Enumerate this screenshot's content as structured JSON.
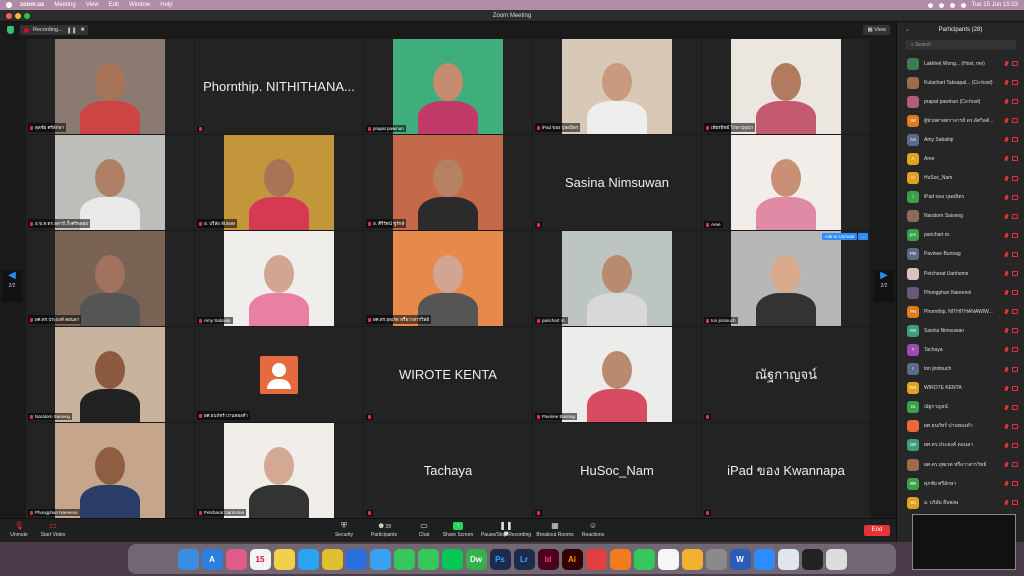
{
  "menubar": {
    "app": "zoom.us",
    "items": [
      "Meeting",
      "View",
      "Edit",
      "Window",
      "Help"
    ],
    "clock": "Tue 15 Jun  15:23"
  },
  "window": {
    "title": "Zoom Meeting"
  },
  "topbar": {
    "recording": "Recording...",
    "view": "View"
  },
  "navigation": {
    "page": "2/2"
  },
  "tiles": [
    {
      "label": "ดุลชัย ศรีลักษา",
      "kind": "video",
      "bg": "#8a7a72",
      "skin": "#a87458",
      "shirt": "#c44"
    },
    {
      "bigname": "Phornthip. NITHITHANA...",
      "kind": "name"
    },
    {
      "label": "prapat pawinun",
      "kind": "video",
      "bg": "#3fae7c",
      "skin": "#c58b6e",
      "shirt": "#c23a6a"
    },
    {
      "label": "iPad ของ บุษยมิตร",
      "kind": "video",
      "bg": "#d7c9b6",
      "skin": "#c99a7e",
      "shirt": "#eee"
    },
    {
      "label": "เพียรพิชย์ โกษาปุลุณา",
      "kind": "video",
      "bg": "#ece6e1",
      "skin": "#b17b60",
      "shirt": "#c35a6f"
    },
    {
      "label": "อ.ข.ท.ดร.ลดาปี ภิ้งศรีพลอย",
      "kind": "video",
      "bg": "#bdbdb9",
      "skin": "#b08066",
      "shirt": "#e9e9e9"
    },
    {
      "label": "อ. บริลัย ลีบพงษ",
      "kind": "video",
      "bg": "#c4963b",
      "skin": "#a87458",
      "shirt": "#d63a53"
    },
    {
      "label": "อ. ศิริรัตน์ ชูรักษ์",
      "kind": "video",
      "bg": "#c46a4a",
      "skin": "#b68063",
      "shirt": "#2b2b2b"
    },
    {
      "bigname": "Sasina Nimsuwan",
      "kind": "name"
    },
    {
      "label": "Aree",
      "kind": "video",
      "bg": "#f2ede8",
      "skin": "#c99076",
      "shirt": "#e08aa6"
    },
    {
      "label": "ผศ.ดร.ประยงค์ ดอนลา",
      "kind": "video",
      "bg": "#7a6355",
      "skin": "#a1735e",
      "shirt": "#555"
    },
    {
      "label": "Amy Sabaitip",
      "kind": "video",
      "bg": "#f0eeeb",
      "skin": "#d2a592",
      "shirt": "#e97fa3"
    },
    {
      "label": "ผศ.ดร.ยุพเรต หรือวาสารวิทย์",
      "kind": "video",
      "bg": "#e8894c",
      "skin": "#d2a592",
      "shirt": "#555"
    },
    {
      "label": "parichart m.",
      "kind": "video",
      "bg": "#bdc5c2",
      "skin": "#b88a70",
      "shirt": "#d8d8d8"
    },
    {
      "label": "ton jirotouch",
      "kind": "video",
      "bg": "#b7b7b7",
      "skin": "#d9a98b",
      "shirt": "#333",
      "ask": "Ask to Unmute",
      "more": "..."
    },
    {
      "label": "Naratorn Saiseng",
      "kind": "video",
      "bg": "#c8b39f",
      "skin": "#8c5a3e",
      "shirt": "#222"
    },
    {
      "label": "ผศ.ธนกัทร์ ปานทองคำ",
      "kind": "avatar"
    },
    {
      "bigname": "WIROTE KENTA",
      "kind": "name"
    },
    {
      "label": "Pavinee Bunnag",
      "kind": "video",
      "bg": "#ececea",
      "skin": "#b98a70",
      "shirt": "#d84c62"
    },
    {
      "bigname": "ณัฐกาญจน์",
      "kind": "name"
    },
    {
      "label": "Phongphan Nareenoi",
      "kind": "video",
      "bg": "#c5a58b",
      "skin": "#8f5e42",
      "shirt": "#2a3d66"
    },
    {
      "label": "Petcharat Uanhome",
      "kind": "video",
      "bg": "#f1eee9",
      "skin": "#d3a994",
      "shirt": "#333"
    },
    {
      "bigname": "Tachaya",
      "kind": "name"
    },
    {
      "bigname": "HuSoc_Nam",
      "kind": "name"
    },
    {
      "bigname": "iPad ของ Kwannapa",
      "kind": "name"
    }
  ],
  "controls": {
    "unmute": "Unmute",
    "start_video": "Start Video",
    "security": "Security",
    "participants": "Participants",
    "participants_count": "28",
    "chat": "Chat",
    "share_screen": "Share Screen",
    "pause_stop": "Pause/Stop Recording",
    "breakout": "Breakout Rooms",
    "reactions": "Reactions",
    "end": "End"
  },
  "panel": {
    "title": "Participants (28)",
    "search_placeholder": "Search",
    "participants": [
      {
        "name": "Lakkhet Wong... (Host, me)",
        "init": "",
        "color": "#3d7a55"
      },
      {
        "name": "Kulachart Taksapal... (Co-host)",
        "init": "",
        "color": "#9b6b4a"
      },
      {
        "name": "prapat pawinun (Co-host)",
        "init": "",
        "color": "#b45b7a"
      },
      {
        "name": "ผู้ช่วยศาสตราจารย์ ดร.อัศวิลต์...",
        "init": "ผศ",
        "color": "#e07a1f"
      },
      {
        "name": "Amy Sabaitip",
        "init": "AS",
        "color": "#5b6b8a"
      },
      {
        "name": "Aree",
        "init": "A",
        "color": "#e0a21f"
      },
      {
        "name": "HuSoc_Nam",
        "init": "H",
        "color": "#e0a21f"
      },
      {
        "name": "iPad ของ บุษยมิตร",
        "init": "i",
        "color": "#3aa04a"
      },
      {
        "name": "Naratorn Saiseng",
        "init": "",
        "color": "#8a6a5a"
      },
      {
        "name": "parichart m.",
        "init": "pm",
        "color": "#3aa04a"
      },
      {
        "name": "Pavinee Bunnag",
        "init": "PB",
        "color": "#5b6b8a"
      },
      {
        "name": "Petcharat Uanhome",
        "init": "",
        "color": "#d7c3bd"
      },
      {
        "name": "Phongphan Nareenoi",
        "init": "",
        "color": "#6a5a7a"
      },
      {
        "name": "Phornthip. NITHITHANAWIW...",
        "init": "PN",
        "color": "#e07a1f"
      },
      {
        "name": "Sasina Nimsuwan",
        "init": "SN",
        "color": "#3aa07a"
      },
      {
        "name": "Tachaya",
        "init": "T",
        "color": "#a04ab4"
      },
      {
        "name": "ton jirotouch",
        "init": "t",
        "color": "#5b6b8a"
      },
      {
        "name": "WIROTE KENTA",
        "init": "WK",
        "color": "#e0a21f"
      },
      {
        "name": "ณัฐกาญจน์",
        "init": "ณ",
        "color": "#3aa04a"
      },
      {
        "name": "ผศ.ธนกัทร์ ปานทองคำ",
        "init": "",
        "color": "#e76a3e"
      },
      {
        "name": "ผศ.ดร.ประยงค์ ดอนลา",
        "init": "ผศ",
        "color": "#3aa07a"
      },
      {
        "name": "ผศ.ดร.ยุพเรต หรือวาสารวิทย์",
        "init": "",
        "color": "#9b6b4a"
      },
      {
        "name": "ศุภชัย ศรีลักษา",
        "init": "ศศ",
        "color": "#3aa04a"
      },
      {
        "name": "อ. บริลัย ลีบพงษ",
        "init": "อบ",
        "color": "#e0a21f"
      }
    ]
  },
  "dock": {
    "icons": [
      {
        "t": "",
        "c": "#3b8de0"
      },
      {
        "t": "A",
        "c": "#2a7fe0"
      },
      {
        "t": "",
        "c": "#e05a8a"
      },
      {
        "t": "15",
        "c": "#f4f4f4",
        "fg": "#e03"
      },
      {
        "t": "",
        "c": "#f4d04a"
      },
      {
        "t": "",
        "c": "#2aa3f0"
      },
      {
        "t": "",
        "c": "#e0c030"
      },
      {
        "t": "",
        "c": "#2a6fe0"
      },
      {
        "t": "",
        "c": "#3aa0f0"
      },
      {
        "t": "",
        "c": "#34c759"
      },
      {
        "t": "",
        "c": "#34c759"
      },
      {
        "t": "",
        "c": "#06c755"
      },
      {
        "t": "Dw",
        "c": "#35b04a"
      },
      {
        "t": "Ps",
        "c": "#1c2b4a",
        "fg": "#31a8ff"
      },
      {
        "t": "Lr",
        "c": "#1c2b4a",
        "fg": "#31a8ff"
      },
      {
        "t": "Id",
        "c": "#49021f",
        "fg": "#ff3366"
      },
      {
        "t": "Ai",
        "c": "#330000",
        "fg": "#ff9a00"
      },
      {
        "t": "",
        "c": "#e04040"
      },
      {
        "t": "",
        "c": "#f47a20"
      },
      {
        "t": "",
        "c": "#34c759"
      },
      {
        "t": "",
        "c": "#f6f6f6"
      },
      {
        "t": "",
        "c": "#f4b030"
      },
      {
        "t": "",
        "c": "#8a8a8a"
      },
      {
        "t": "W",
        "c": "#2b5cb8"
      },
      {
        "t": "",
        "c": "#2d8cff"
      },
      {
        "t": "",
        "c": "#dfe6ee"
      },
      {
        "t": "",
        "c": "#222"
      },
      {
        "t": "",
        "c": "#ddd"
      }
    ]
  }
}
